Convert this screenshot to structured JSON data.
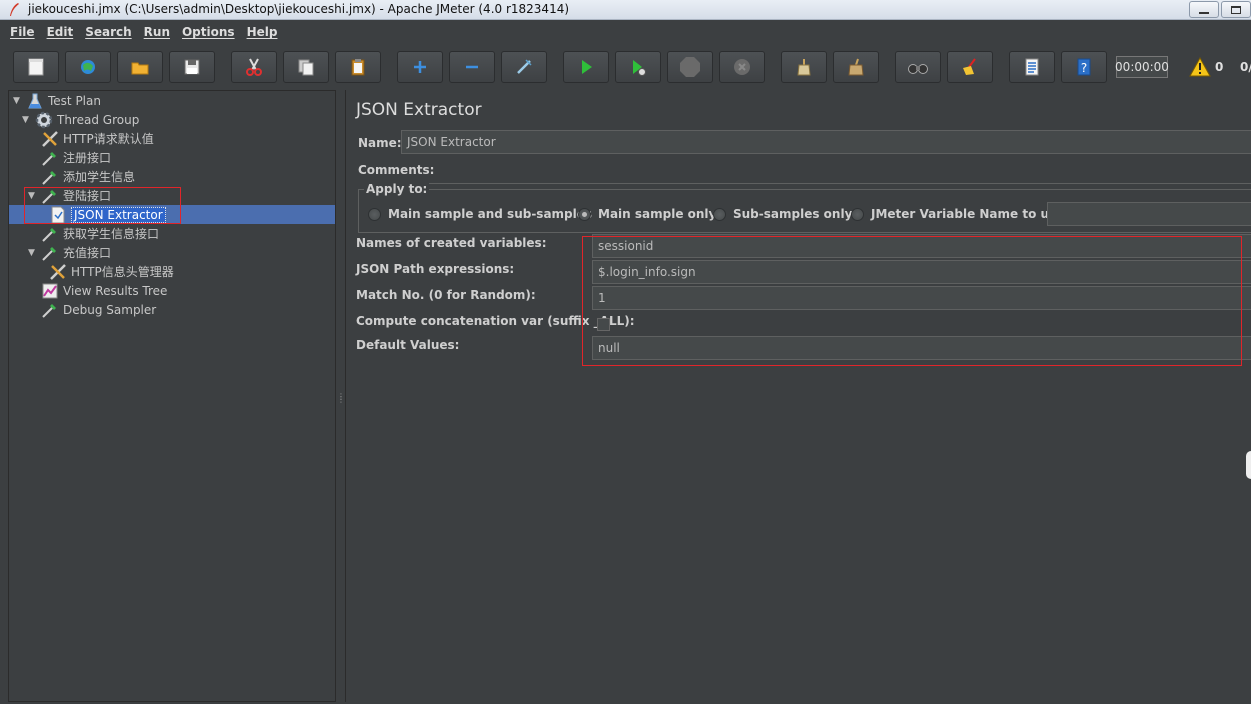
{
  "window": {
    "title": "jiekouceshi.jmx (C:\\Users\\admin\\Desktop\\jiekouceshi.jmx) - Apache JMeter (4.0 r1823414)"
  },
  "menu": [
    {
      "label": "File"
    },
    {
      "label": "Edit"
    },
    {
      "label": "Search"
    },
    {
      "label": "Run"
    },
    {
      "label": "Options"
    },
    {
      "label": "Help"
    }
  ],
  "toolbar": {
    "timer": "00:00:00",
    "warning_count": "0",
    "thread_count": "0/"
  },
  "tree": [
    {
      "label": "Test Plan",
      "icon": "test-plan-icon"
    },
    {
      "label": "Thread Group",
      "icon": "gear-icon"
    },
    {
      "label": "HTTP请求默认值",
      "icon": "wrench-icon"
    },
    {
      "label": "注册接口",
      "icon": "pipette-icon"
    },
    {
      "label": "添加学生信息",
      "icon": "pipette-icon"
    },
    {
      "label": "登陆接口",
      "icon": "pipette-icon"
    },
    {
      "label": "JSON Extractor",
      "icon": "document-icon"
    },
    {
      "label": "获取学生信息接口",
      "icon": "pipette-icon"
    },
    {
      "label": "充值接口",
      "icon": "pipette-icon"
    },
    {
      "label": "HTTP信息头管理器",
      "icon": "wrench-icon"
    },
    {
      "label": "View Results Tree",
      "icon": "chart-icon"
    },
    {
      "label": "Debug Sampler",
      "icon": "pipette-icon"
    }
  ],
  "editor": {
    "title": "JSON Extractor",
    "name_label": "Name:",
    "name_value": "JSON Extractor",
    "comments_label": "Comments:",
    "apply_to_label": "Apply to:",
    "apply_options": [
      {
        "label": "Main sample and sub-samples"
      },
      {
        "label": "Main sample only"
      },
      {
        "label": "Sub-samples only"
      },
      {
        "label": "JMeter Variable Name to use"
      }
    ],
    "fields": [
      {
        "label": "Names of created variables:",
        "value": "sessionid"
      },
      {
        "label": "JSON Path expressions:",
        "value": "$.login_info.sign"
      },
      {
        "label": "Match No. (0 for Random):",
        "value": "1"
      },
      {
        "label": "Compute concatenation var (suffix _ALL):",
        "value": ""
      },
      {
        "label": "Default Values:",
        "value": "null"
      }
    ]
  }
}
